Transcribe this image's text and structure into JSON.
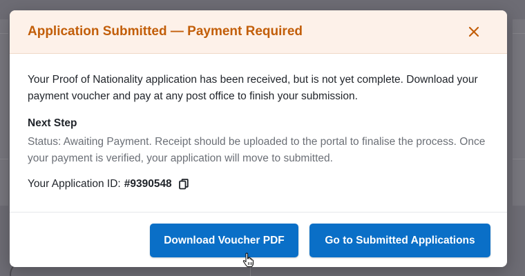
{
  "modal": {
    "title": "Application Submitted — Payment Required",
    "intro": "Your Proof of Nationality application has been received, but is not yet complete. Download your payment voucher and pay at any post office to finish your submission.",
    "next_step_title": "Next Step",
    "status_text": "Status: Awaiting Payment. Receipt should be uploaded to the portal to finalise the process. Once your payment is verified, your application will move to submitted.",
    "application_id_label": "Your Application ID:",
    "application_id_value": "#9390548",
    "download_button_label": "Download Voucher PDF",
    "go_button_label": "Go to Submitted Applications"
  },
  "icons": {
    "close": "close-icon",
    "copy": "copy-icon",
    "cursor": "hand-pointer-cursor"
  },
  "colors": {
    "title": "#c25e09",
    "header_bg": "#fdf1e9",
    "primary_button": "#0a6fc7",
    "backdrop": "#6d6c74"
  }
}
